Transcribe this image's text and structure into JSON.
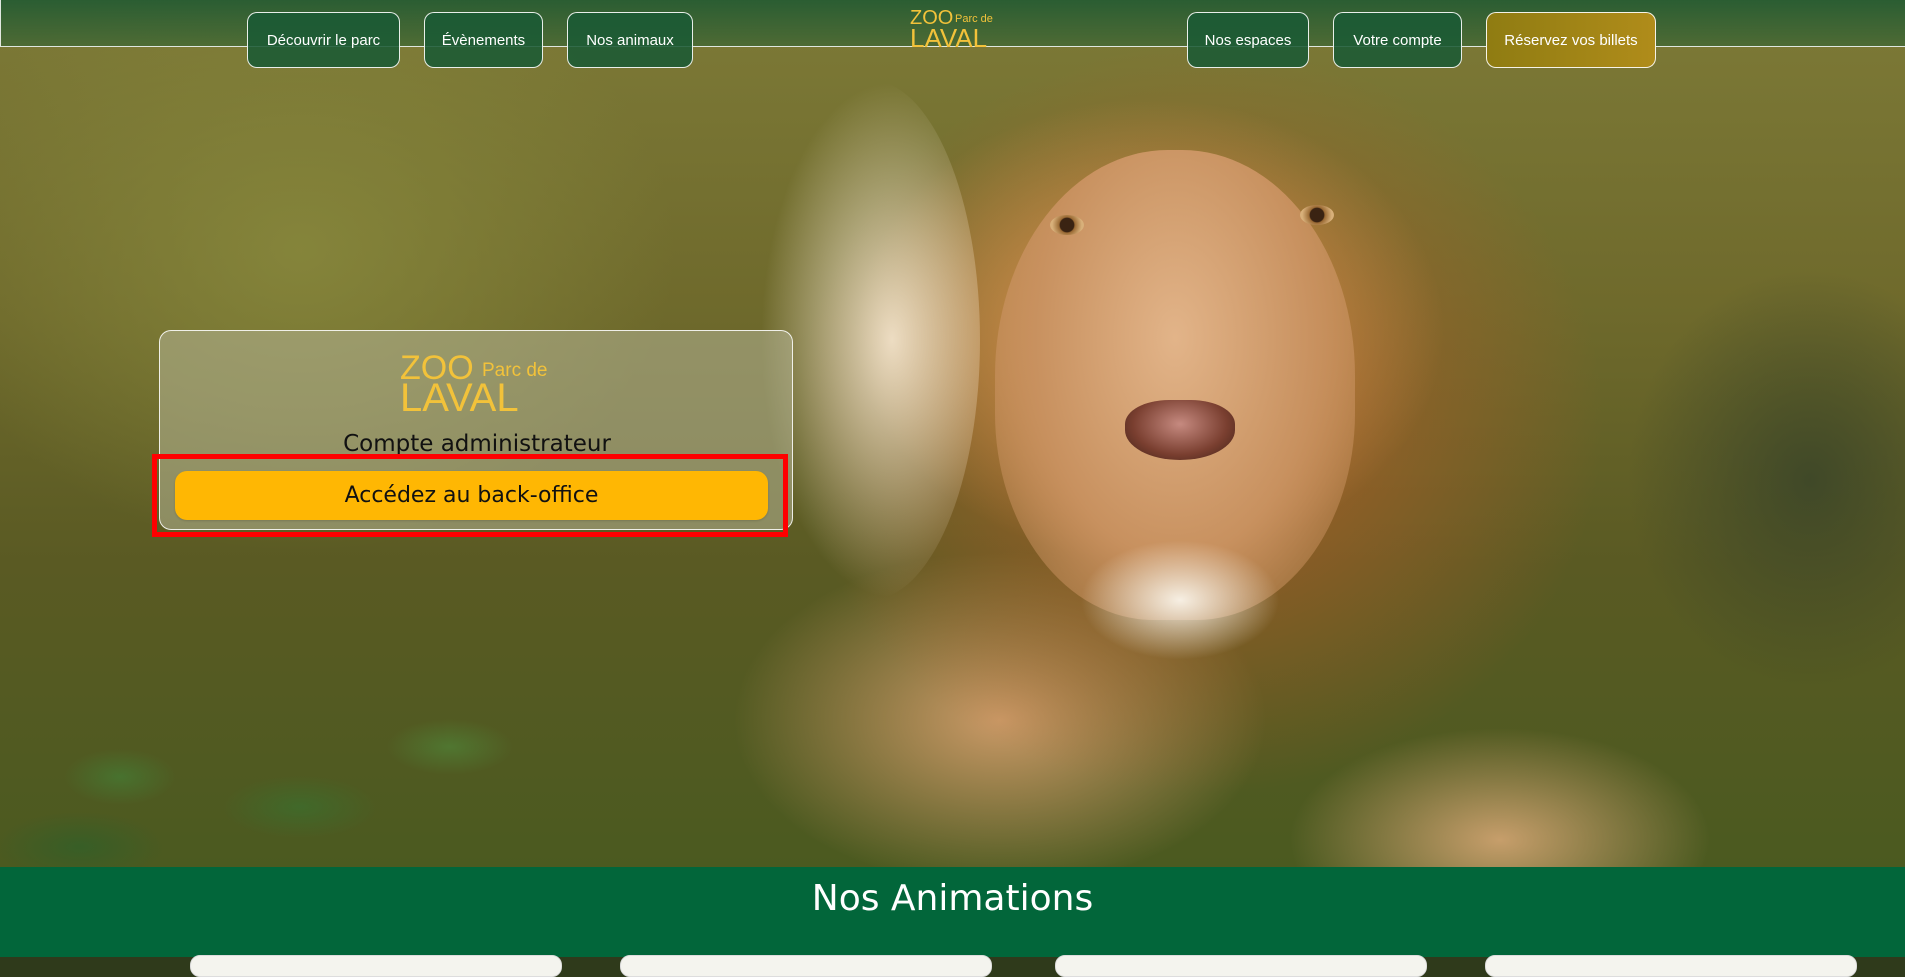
{
  "nav": {
    "left": [
      {
        "label": "Découvrir le parc"
      },
      {
        "label": "Évènements"
      },
      {
        "label": "Nos animaux"
      }
    ],
    "right": [
      {
        "label": "Nos espaces"
      },
      {
        "label": "Votre compte"
      },
      {
        "label": "Réservez vos billets"
      }
    ]
  },
  "logo": {
    "zoo": "ZOO",
    "parc": "Parc de",
    "laval": "LAVAL"
  },
  "card": {
    "title": "Compte administrateur",
    "button_label": "Accédez au back-office"
  },
  "section": {
    "title": "Nos Animations"
  },
  "colors": {
    "brand_green": "#02663a",
    "logo_gold": "#f2c23a",
    "button_yellow": "#ffb703",
    "highlight_red": "#ff0000"
  }
}
